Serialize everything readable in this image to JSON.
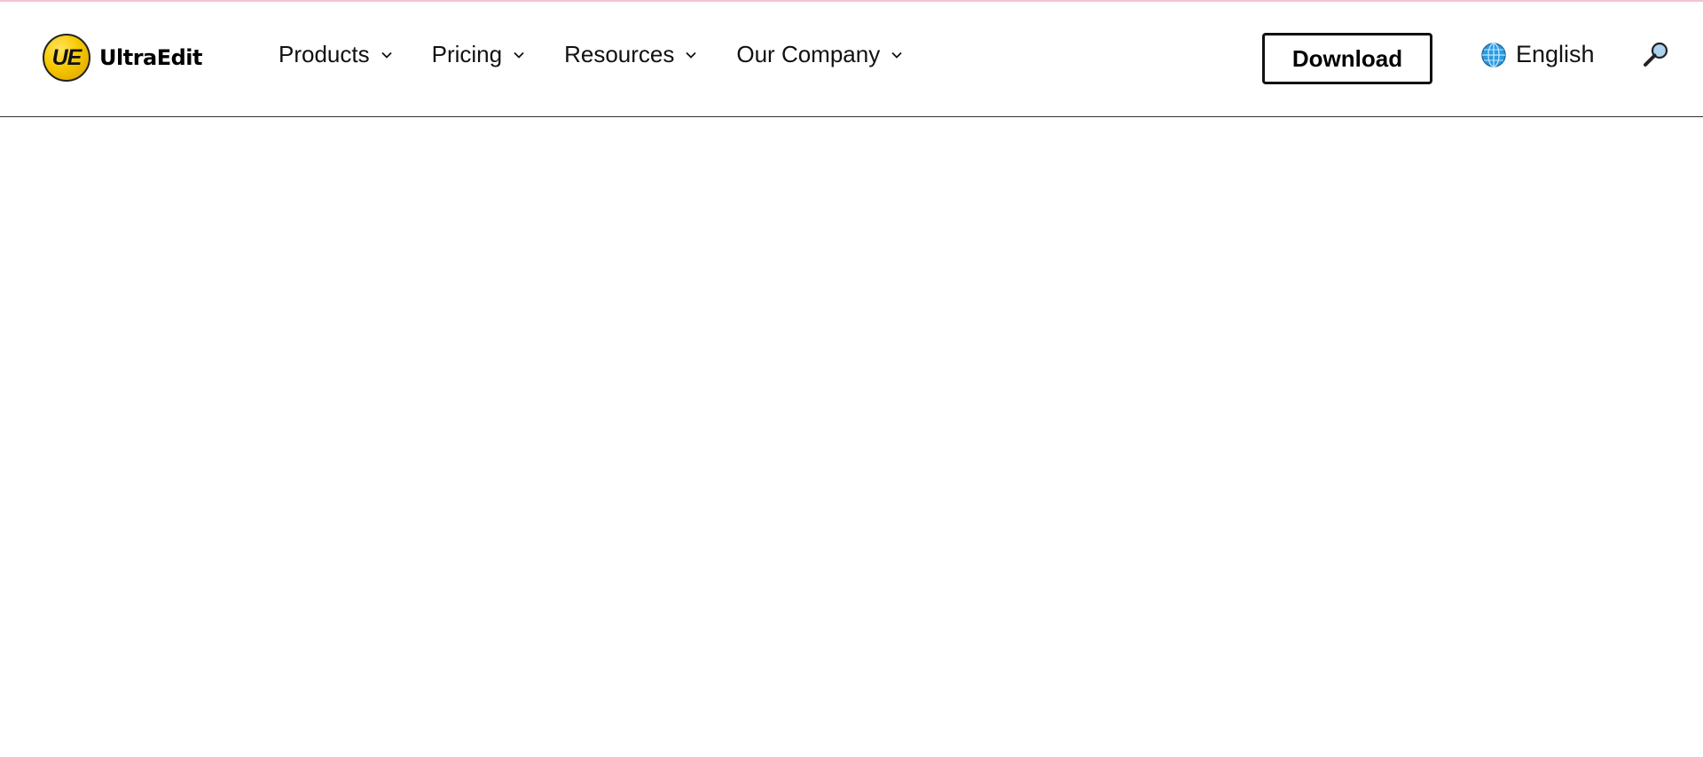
{
  "header": {
    "logo": {
      "badge_text": "UE",
      "brand_name": "UltraEdit"
    },
    "nav": [
      {
        "label": "Products",
        "icon": "chevron-down-icon"
      },
      {
        "label": "Pricing",
        "icon": "chevron-down-icon"
      },
      {
        "label": "Resources",
        "icon": "chevron-down-icon"
      },
      {
        "label": "Our Company",
        "icon": "chevron-down-icon"
      }
    ],
    "download_label": "Download",
    "language": {
      "label": "English",
      "icon": "globe-icon"
    },
    "search_icon": "search-icon"
  },
  "colors": {
    "logo_yellow": "#f7c800",
    "top_accent": "#f2c4cf",
    "header_border": "#333333",
    "globe_blue": "#2b9be0"
  }
}
